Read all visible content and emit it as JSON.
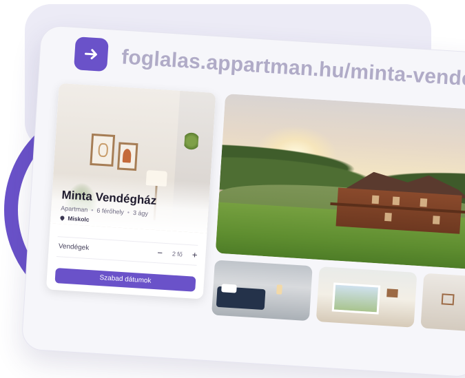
{
  "browser": {
    "url": "foglalas.appartman.hu/minta-vendeghaz",
    "go_icon": "arrow-right-icon"
  },
  "listing": {
    "title": "Minta Vendégház",
    "type": "Apartman",
    "capacity": "6 férőhely",
    "beds": "3 ágy",
    "location": "Miskolc",
    "location_icon": "map-pin-icon"
  },
  "booking": {
    "guests_label": "Vendégek",
    "guests_value": "2 fő",
    "decrement_symbol": "−",
    "increment_symbol": "+",
    "cta_label": "Szabad dátumok"
  },
  "colors": {
    "accent": "#6a52c9",
    "url_text": "#b0abc7",
    "panel_bg": "#ecebf6"
  }
}
